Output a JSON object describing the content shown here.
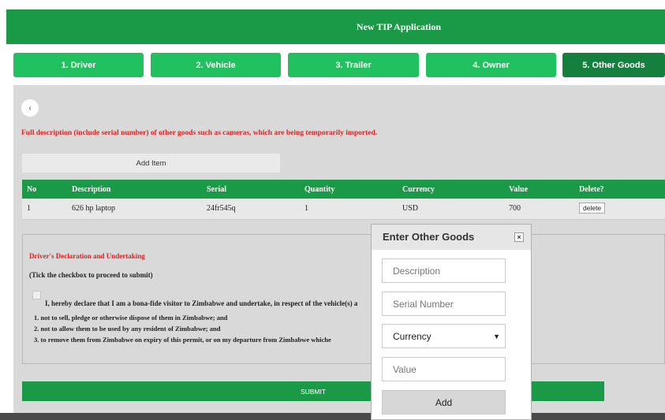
{
  "header": {
    "title": "New TIP Application"
  },
  "tabs": [
    {
      "label": "1. Driver"
    },
    {
      "label": "2. Vehicle"
    },
    {
      "label": "3. Trailer"
    },
    {
      "label": "4. Owner"
    },
    {
      "label": "5. Other Goods",
      "active": true
    }
  ],
  "main": {
    "back_icon": "‹",
    "note": "Full description (include serial number) of other goods such as cameras, which are being temporarily imported.",
    "add_item_label": "Add Item",
    "submit_label": "SUBMIT"
  },
  "table": {
    "columns": [
      "No",
      "Description",
      "Serial",
      "Quantity",
      "Currency",
      "Value",
      "Delete?"
    ],
    "rows": [
      {
        "no": "1",
        "description": "626 hp laptop",
        "serial": "24fr545q",
        "quantity": "1",
        "currency": "USD",
        "value": "700",
        "delete_label": "delete"
      }
    ]
  },
  "declaration": {
    "title": "Driver's Declaration and Undertaking",
    "tick_note": "(Tick the checkbox to proceed to submit)",
    "statement": "I, hereby declare that I am a bona-fide visitor to Zimbabwe and undertake, in respect of the vehicle(s) a",
    "items": [
      "1. not to sell, pledge or otherwise dispose of them in Zimbabwe; and",
      "2. not to allow them to be used by any resident of Zimbabwe; and",
      "3. to remove them from Zimbabwe on expiry of this permit, or on my departure from Zimbabwe whiche"
    ]
  },
  "modal": {
    "title": "Enter Other Goods",
    "close_icon": "×",
    "description_placeholder": "Description",
    "serial_placeholder": "Serial Number",
    "currency_selected": "Currency",
    "value_placeholder": "Value",
    "add_label": "Add"
  },
  "colors": {
    "green": "#1a9a47",
    "tab_green": "#21c15f",
    "active_tab": "#15803d",
    "alert_red": "#e52020"
  }
}
